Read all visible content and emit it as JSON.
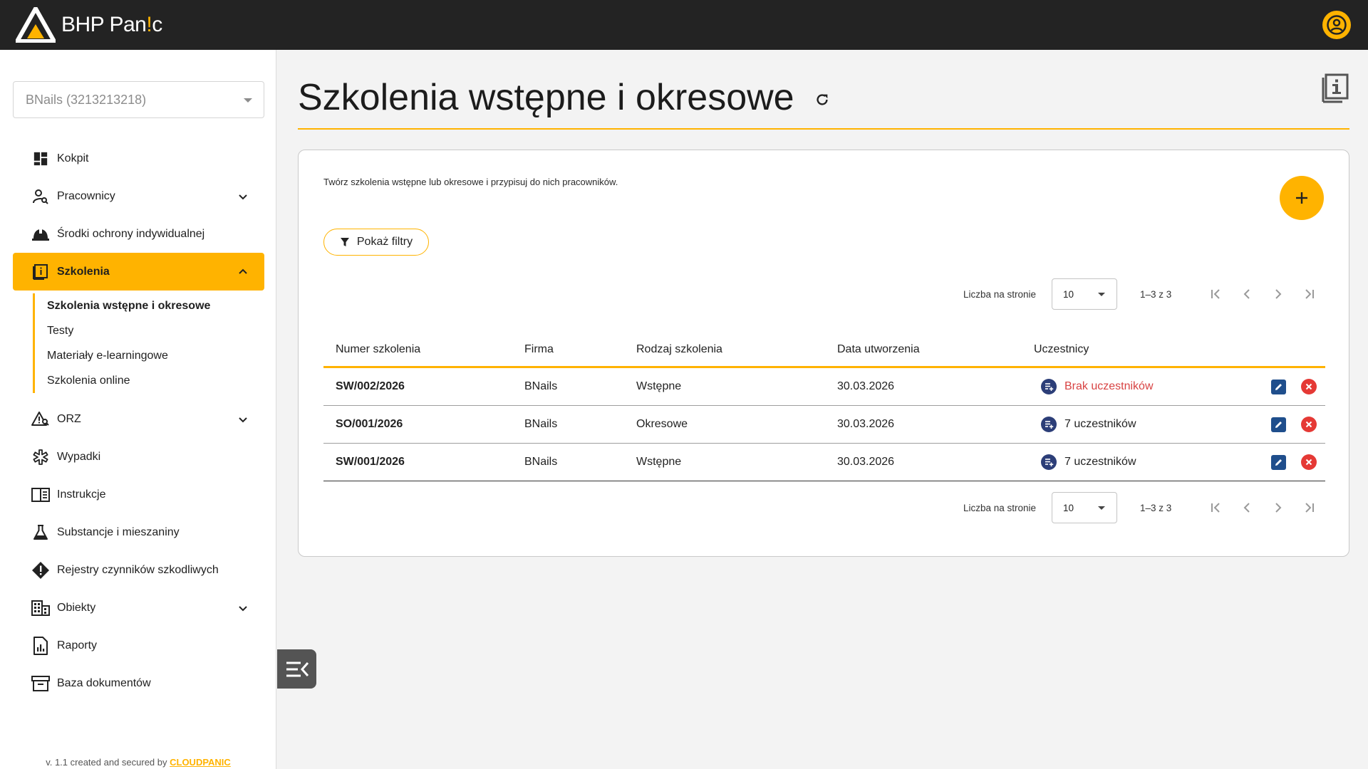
{
  "app": {
    "brand_prefix": "BHP Pan",
    "brand_accent": "!",
    "brand_suffix": "c"
  },
  "sidebar": {
    "company": "BNails (3213213218)",
    "items": [
      {
        "label": "Kokpit",
        "icon": "dashboard-icon"
      },
      {
        "label": "Pracownicy",
        "icon": "person-search-icon",
        "expandable": true
      },
      {
        "label": "Środki ochrony indywidualnej",
        "icon": "helmet-icon"
      },
      {
        "label": "Szkolenia",
        "icon": "training-book-icon",
        "expandable": true,
        "expanded": true
      },
      {
        "label": "ORZ",
        "icon": "risk-warning-icon",
        "expandable": true
      },
      {
        "label": "Wypadki",
        "icon": "medical-star-icon"
      },
      {
        "label": "Instrukcje",
        "icon": "instructions-book-icon"
      },
      {
        "label": "Substancje i mieszaniny",
        "icon": "flask-icon"
      },
      {
        "label": "Rejestry czynników szkodliwych",
        "icon": "warning-diamond-icon"
      },
      {
        "label": "Obiekty",
        "icon": "building-icon",
        "expandable": true
      },
      {
        "label": "Raporty",
        "icon": "report-icon"
      },
      {
        "label": "Baza dokumentów",
        "icon": "archive-icon"
      }
    ],
    "subitems": [
      {
        "label": "Szkolenia wstępne i okresowe",
        "current": true
      },
      {
        "label": "Testy"
      },
      {
        "label": "Materiały e-learningowe"
      },
      {
        "label": "Szkolenia online"
      }
    ],
    "footer_text": "v. 1.1 created and secured by ",
    "footer_link": "CLOUDPANIC"
  },
  "main": {
    "title": "Szkolenia wstępne i okresowe",
    "intro": "Twórz szkolenia wstępne lub okresowe i przypisuj do nich pracowników.",
    "filter_label": "Pokaż filtry",
    "pager": {
      "per_page_label": "Liczba na stronie",
      "per_page_value": "10",
      "range": "1–3 z 3"
    },
    "table": {
      "headers": [
        "Numer szkolenia",
        "Firma",
        "Rodzaj szkolenia",
        "Data utworzenia",
        "Uczestnicy"
      ],
      "rows": [
        {
          "number": "SW/002/2026",
          "company": "BNails",
          "type": "Wstępne",
          "date": "30.03.2026",
          "participants": "Brak uczestników",
          "empty": true
        },
        {
          "number": "SO/001/2026",
          "company": "BNails",
          "type": "Okresowe",
          "date": "30.03.2026",
          "participants": "7 uczestników",
          "empty": false
        },
        {
          "number": "SW/001/2026",
          "company": "BNails",
          "type": "Wstępne",
          "date": "30.03.2026",
          "participants": "7 uczestników",
          "empty": false
        }
      ]
    }
  },
  "colors": {
    "accent": "#ffb300",
    "topbar": "#232323",
    "danger": "#e53935",
    "edit": "#1f4e8c",
    "participants_icon": "#2c3e78",
    "empty_text": "#d84343"
  }
}
